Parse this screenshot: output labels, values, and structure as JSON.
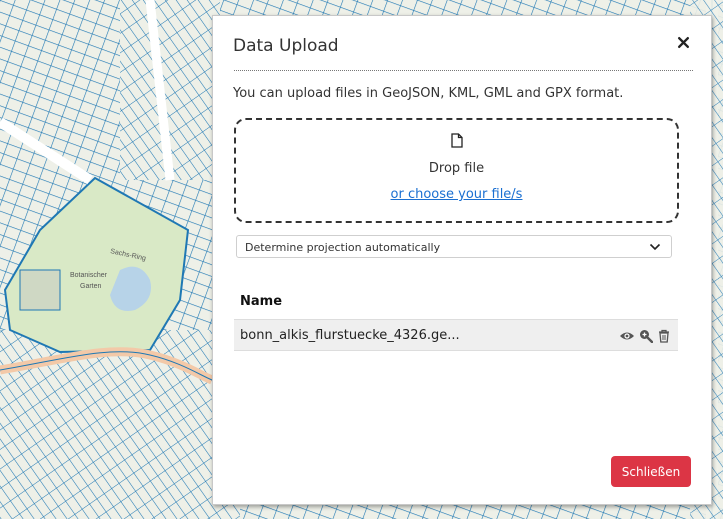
{
  "map": {
    "labels": [
      "Sachs-Ring",
      "Botanischer",
      "Garten"
    ]
  },
  "dialog": {
    "title": "Data Upload",
    "close_icon": "close-icon",
    "intro": "You can upload files in GeoJSON, KML, GML and GPX format.",
    "dropzone": {
      "icon": "file-icon",
      "text": "Drop file",
      "choose_link": "or choose your file/s"
    },
    "projection": {
      "selected": "Determine projection automatically"
    },
    "table": {
      "header": "Name",
      "rows": [
        {
          "name": "bonn_alkis_flurstuecke_4326.ge...",
          "actions": [
            "eye-icon",
            "zoom-icon",
            "trash-icon"
          ]
        }
      ]
    },
    "close_button": "Schließen"
  },
  "colors": {
    "parcel_lines": "#1f78b4",
    "primary_red": "#dc3545",
    "link": "#1a6fd1"
  }
}
